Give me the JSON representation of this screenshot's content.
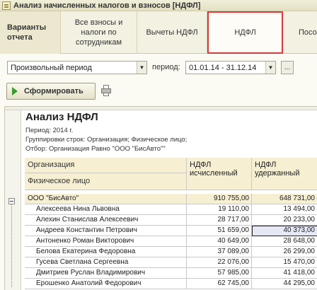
{
  "window": {
    "title": "Анализ начисленных налогов и взносов [НДФЛ]"
  },
  "tabs": [
    {
      "label": "Варианты отчета"
    },
    {
      "label": "Все взносы и налоги по сотрудникам"
    },
    {
      "label": "Вычеты НДФЛ"
    },
    {
      "label": "НДФЛ"
    },
    {
      "label": "Посо"
    }
  ],
  "filters": {
    "period_type": "Произвольный период",
    "period_label": "период:",
    "period_value": "01.01.14 - 31.12.14",
    "more_label": "..."
  },
  "toolbar": {
    "generate_label": "Сформировать"
  },
  "report": {
    "title": "Анализ НДФЛ",
    "period_line": "Период: 2014 г.",
    "grouping_line": "Группировки строк: Организация; Физическое лицо;",
    "filter_line": "Отбор: Организация Равно \"ООО \"БисАвто\"\"",
    "col_org": "Организация",
    "col_person": "Физическое лицо",
    "col_calc_1": "НДФЛ",
    "col_calc_2": "исчисленный",
    "col_held_1": "НДФЛ",
    "col_held_2": "удержанный",
    "org_row": {
      "name": "ООО \"БисАвто\"",
      "calc": "910 755,00",
      "held": "648 731,00"
    },
    "rows": [
      {
        "name": "Алексеева Нина Львовна",
        "calc": "19 110,00",
        "held": "13 494,00"
      },
      {
        "name": "Алехин Станислав Алексеевич",
        "calc": "28 717,00",
        "held": "20 233,00"
      },
      {
        "name": "Андреев Константин Петрович",
        "calc": "51 659,00",
        "held": "40 373,00"
      },
      {
        "name": "Антоненко Роман Викторович",
        "calc": "40 649,00",
        "held": "28 648,00"
      },
      {
        "name": "Белова Екатерина Федоровна",
        "calc": "37 089,00",
        "held": "26 299,00"
      },
      {
        "name": "Гусева Светлана Сергеевна",
        "calc": "22 076,00",
        "held": "15 470,00"
      },
      {
        "name": "Дмитриев Руслан Владимирович",
        "calc": "57 985,00",
        "held": "41 418,00"
      },
      {
        "name": "Ерошенко Анатолий Федорович",
        "calc": "62 745,00",
        "held": "44 295,00"
      }
    ]
  }
}
